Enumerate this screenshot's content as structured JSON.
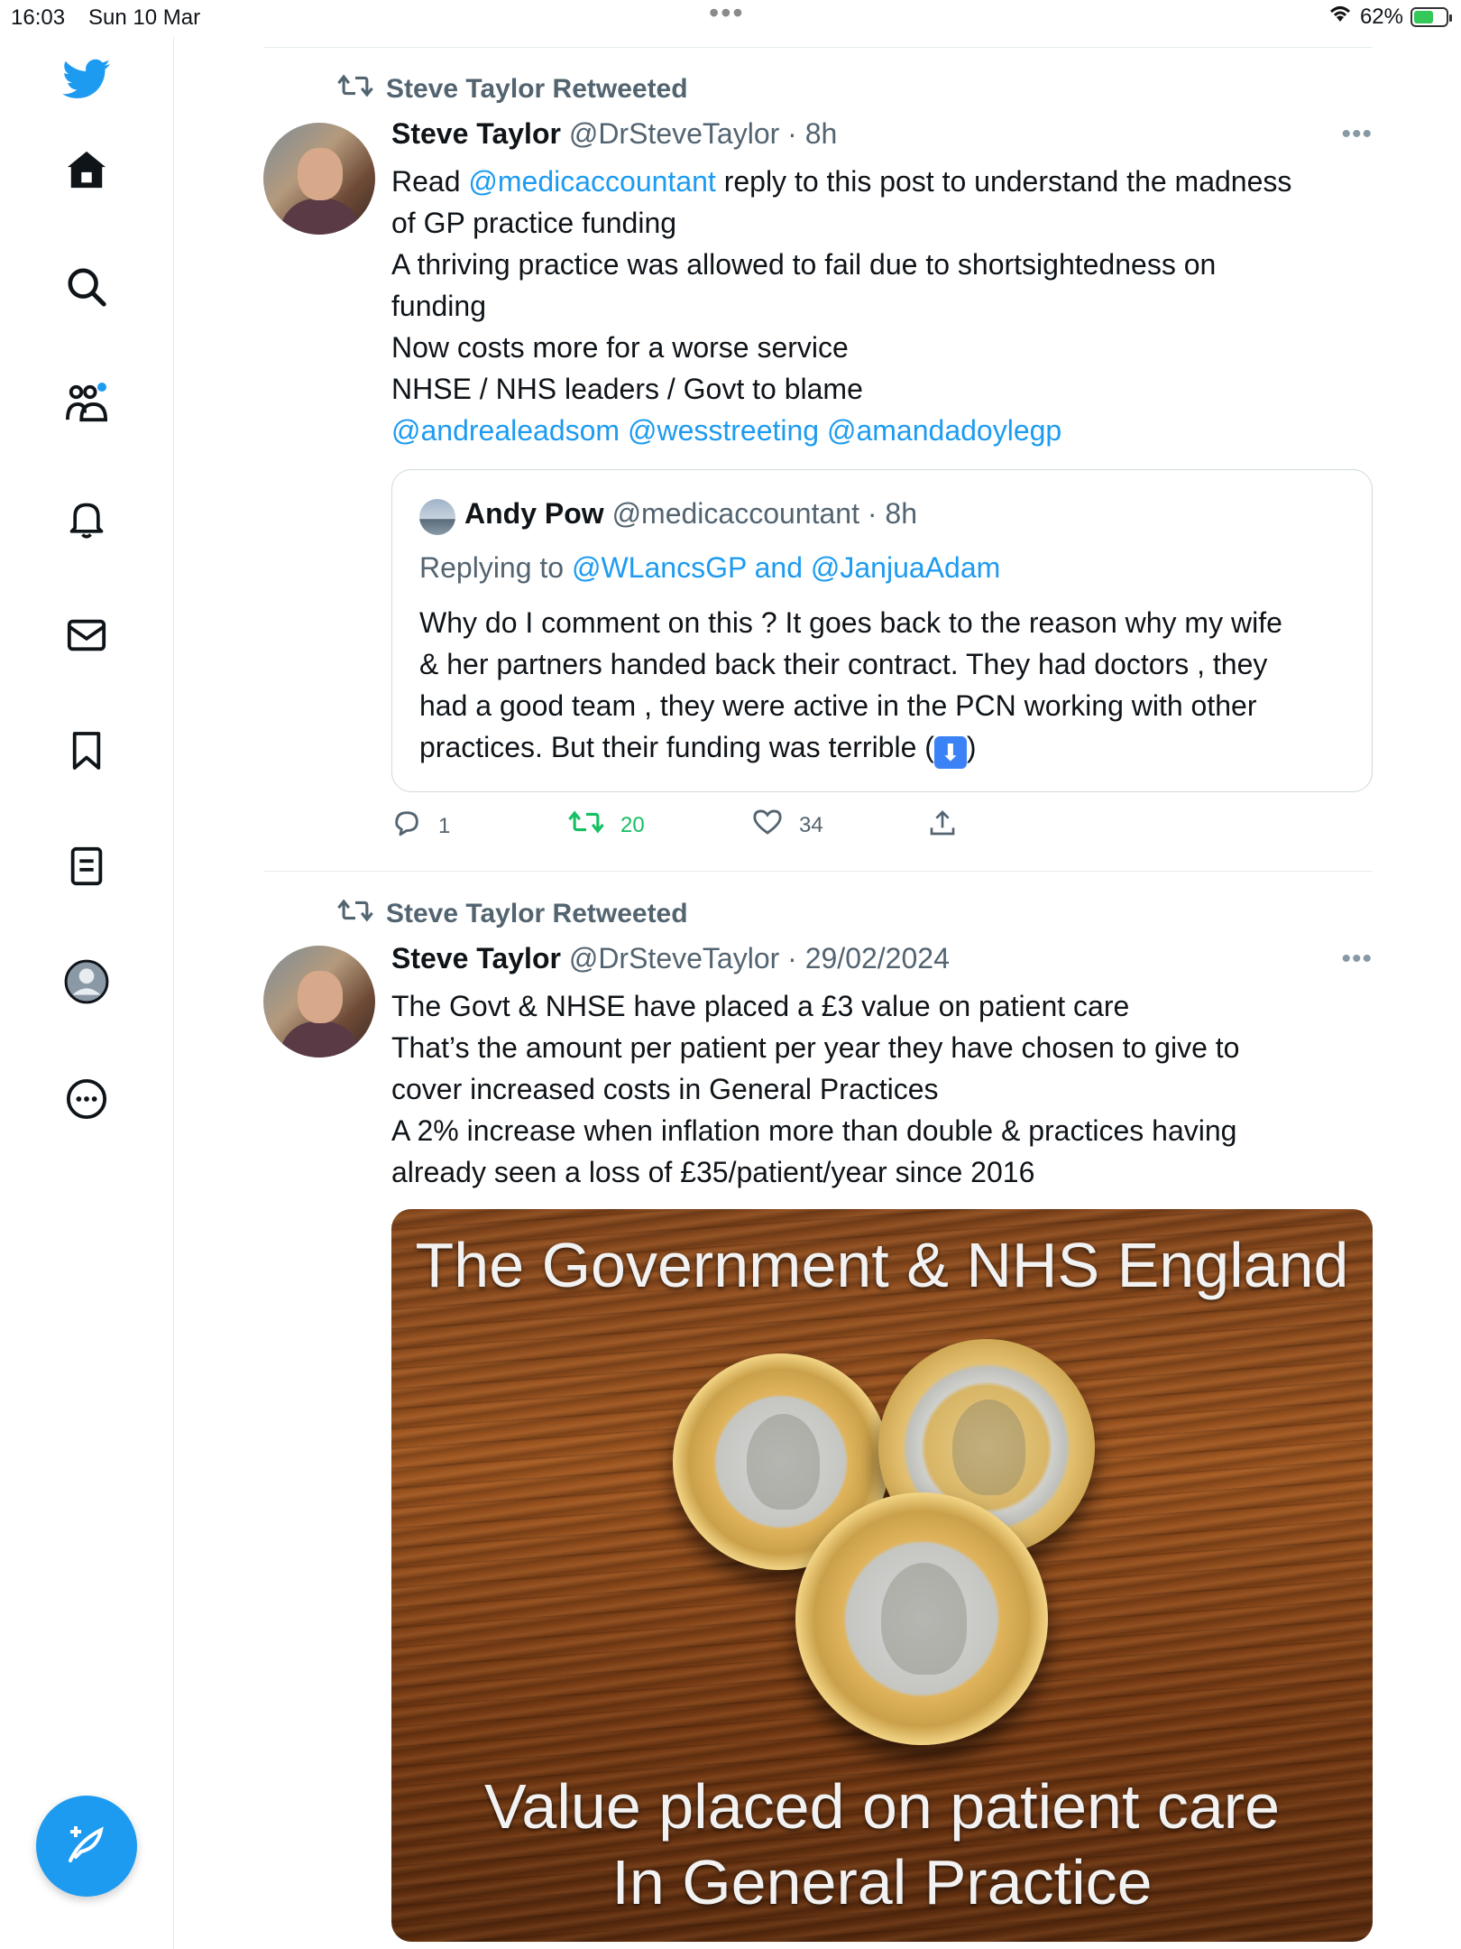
{
  "status_bar": {
    "time": "16:03",
    "date": "Sun 10 Mar",
    "dots": "•••",
    "battery": "62%",
    "battery_level": 0.62
  },
  "sidebar": {
    "items": [
      {
        "icon": "twitter-logo-icon"
      },
      {
        "icon": "home-icon"
      },
      {
        "icon": "search-icon"
      },
      {
        "icon": "communities-icon",
        "has_notification_dot": true
      },
      {
        "icon": "bell-icon"
      },
      {
        "icon": "mail-icon"
      },
      {
        "icon": "bookmark-icon"
      },
      {
        "icon": "lists-icon"
      },
      {
        "icon": "profile-icon"
      },
      {
        "icon": "more-circle-icon"
      }
    ],
    "compose_icon": "compose-icon"
  },
  "colors": {
    "accent": "#1d9bf0",
    "retweet_green": "#17bf63",
    "muted": "#536471"
  },
  "tweets": [
    {
      "retweeted_by": "Steve Taylor Retweeted",
      "author": "Steve Taylor",
      "handle": "@DrSteveTaylor",
      "time": "· 8h",
      "more": "•••",
      "lines": [
        {
          "pre": "Read ",
          "link": "@medicaccountant",
          "post": " reply to this post to understand the madness"
        },
        "of GP practice funding",
        "A thriving practice was allowed to fail due to shortsightedness on",
        "funding",
        "Now costs more for a worse service",
        "NHSE / NHS leaders / Govt to blame"
      ],
      "mentions_line": "@andrealeadsom @wesstreeting @amandadoylegp",
      "quote": {
        "author": "Andy Pow",
        "handle": "@medicaccountant",
        "time": "· 8h",
        "replying_prefix": "Replying to",
        "replying_to": "@WLancsGP and @JanjuaAdam",
        "lines": [
          "Why do I comment on this ? It goes back to the reason why my wife",
          "& her partners handed back their contract. They had doctors , they",
          "had a good team , they were active in the PCN working with other",
          "practices. But their funding was terrible ("
        ],
        "emoji": "⬇",
        "close": ")"
      },
      "actions": {
        "replies": "1",
        "retweets": "20",
        "likes": "34"
      }
    },
    {
      "retweeted_by": "Steve Taylor Retweeted",
      "author": "Steve Taylor",
      "handle": "@DrSteveTaylor",
      "time": "· 29/02/2024",
      "more": "•••",
      "lines": [
        "The Govt & NHSE have placed a £3 value on patient care",
        "That’s the amount per patient per year they have chosen to give to",
        "cover increased costs in General Practices",
        "A 2% increase when inflation more than double & practices having",
        "already seen a loss of £35/patient/year since 2016"
      ],
      "media": {
        "top_text": "The Government & NHS England",
        "bottom_line1": "Value placed on patient care",
        "bottom_line2": "In General Practice"
      }
    }
  ]
}
